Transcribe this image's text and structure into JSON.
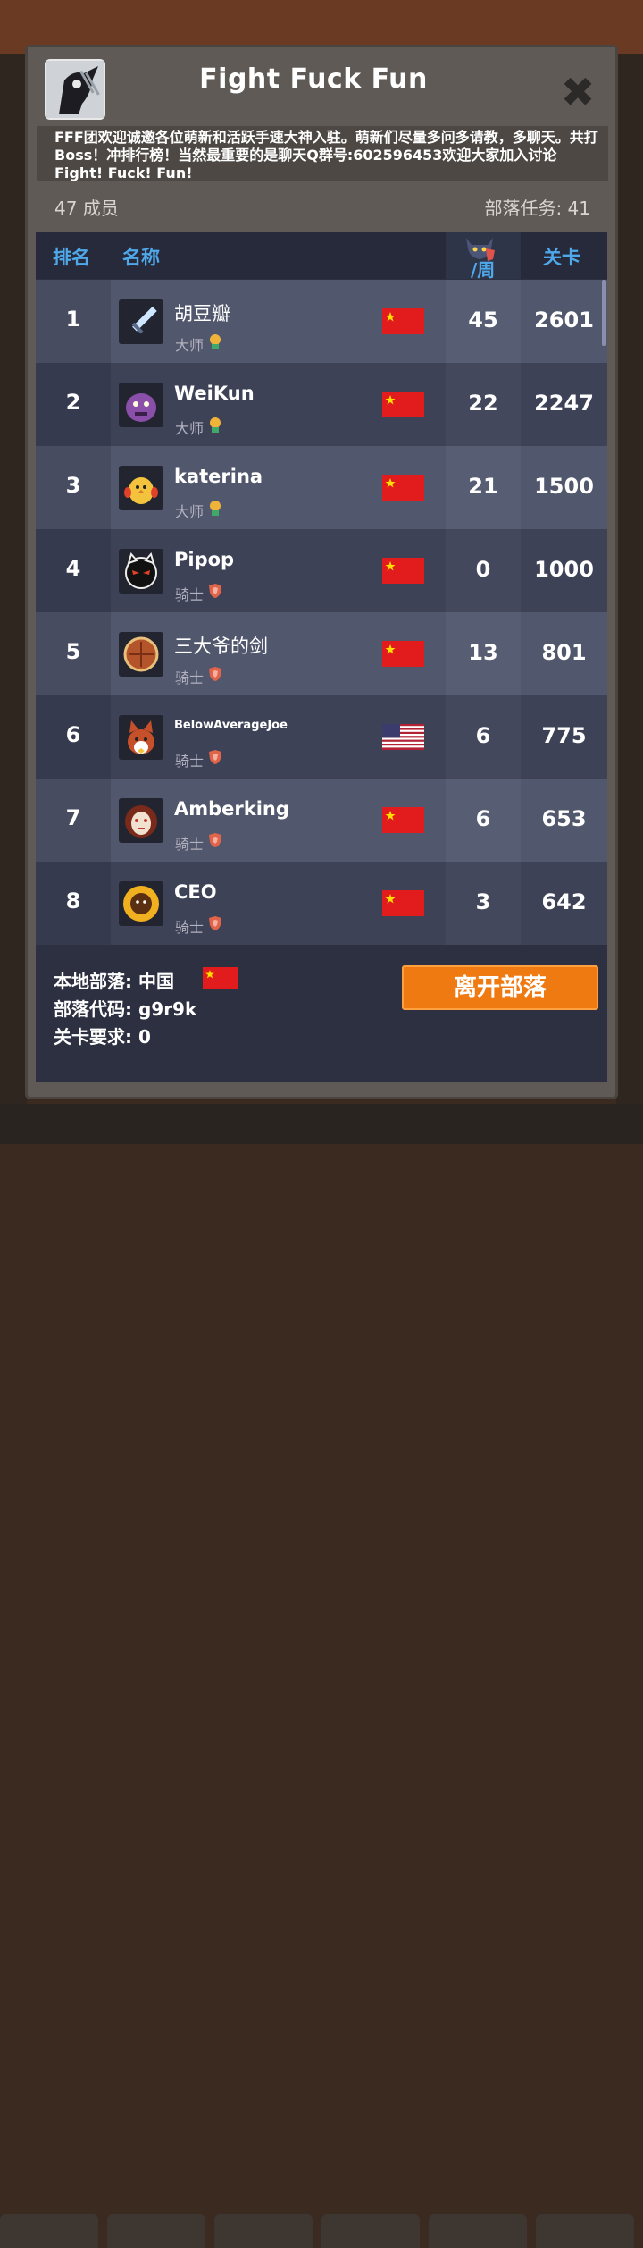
{
  "clan": {
    "title": "Fight Fuck Fun",
    "description": "FFF团欢迎诚邀各位萌新和活跃手速大神入驻。萌新们尽量多问多请教，多聊天。共打Boss！冲排行榜！当然最重要的是聊天Q群号:602596453欢迎大家加入讨论Fight! Fuck! Fun!",
    "members": "47 成员",
    "tasks": "部落任务: 41",
    "close_icon": "✖"
  },
  "table": {
    "headers": {
      "rank": "排名",
      "name": "名称",
      "week": "/周",
      "stage": "关卡"
    },
    "rows": [
      {
        "rank": "1",
        "name": "胡豆瓣",
        "role": "大师",
        "role_icon": "medal-icon",
        "flag": "cn",
        "week": "45",
        "stage": "2601",
        "avatar": "sword-icon"
      },
      {
        "rank": "2",
        "name": "WeiKun",
        "role": "大师",
        "role_icon": "medal-icon",
        "flag": "cn",
        "week": "22",
        "stage": "2247",
        "avatar": "purple-monster-icon"
      },
      {
        "rank": "3",
        "name": "katerina",
        "role": "大师",
        "role_icon": "medal-icon",
        "flag": "cn",
        "week": "21",
        "stage": "1500",
        "avatar": "chick-icon"
      },
      {
        "rank": "4",
        "name": "Pipop",
        "role": "骑士",
        "role_icon": "shield-icon",
        "flag": "cn",
        "week": "0",
        "stage": "1000",
        "avatar": "black-cat-icon"
      },
      {
        "rank": "5",
        "name": "三大爷的剑",
        "role": "骑士",
        "role_icon": "shield-icon",
        "flag": "cn",
        "week": "13",
        "stage": "801",
        "avatar": "round-shield-icon"
      },
      {
        "rank": "6",
        "name": "BelowAverageJoe",
        "role": "骑士",
        "role_icon": "shield-icon",
        "flag": "us",
        "week": "6",
        "stage": "775",
        "avatar": "fox-icon"
      },
      {
        "rank": "7",
        "name": "Amberking",
        "role": "骑士",
        "role_icon": "shield-icon",
        "flag": "cn",
        "week": "6",
        "stage": "653",
        "avatar": "mask-icon"
      },
      {
        "rank": "8",
        "name": "CEO",
        "role": "骑士",
        "role_icon": "shield-icon",
        "flag": "cn",
        "week": "3",
        "stage": "642",
        "avatar": "sunflower-icon"
      }
    ]
  },
  "footer": {
    "local": "本地部落: 中国",
    "code": "部落代码: g9r9k",
    "requirement": "关卡要求: 0",
    "leave_button": "离开部落"
  },
  "colors": {
    "accent": "#4fa8ea",
    "button": "#f07a12"
  }
}
